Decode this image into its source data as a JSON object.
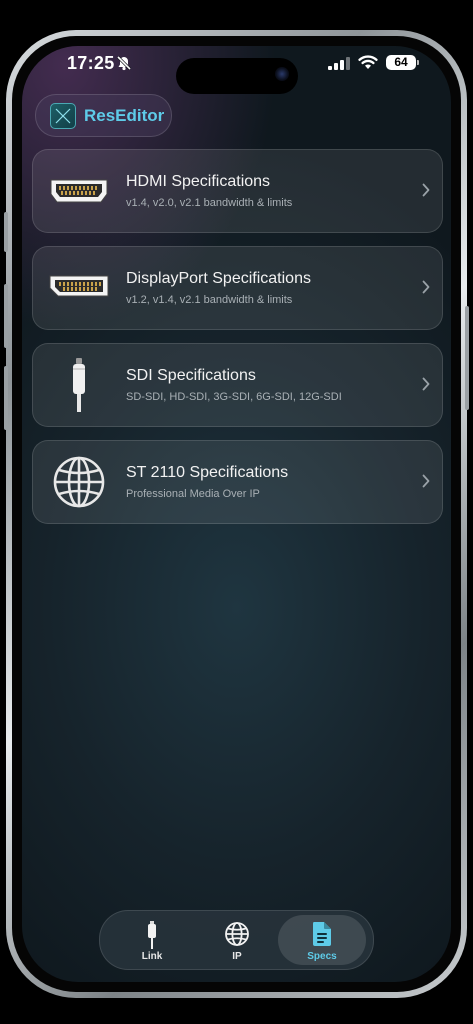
{
  "status_bar": {
    "time": "17:25",
    "battery": "64"
  },
  "app": {
    "name": "ResEditor"
  },
  "cards": [
    {
      "title": "HDMI Specifications",
      "subtitle": "v1.4, v2.0, v2.1 bandwidth & limits",
      "icon": "hdmi-connector-icon"
    },
    {
      "title": "DisplayPort Specifications",
      "subtitle": "v1.2, v1.4, v2.1 bandwidth & limits",
      "icon": "displayport-connector-icon"
    },
    {
      "title": "SDI Specifications",
      "subtitle": "SD-SDI, HD-SDI, 3G-SDI, 6G-SDI, 12G-SDI",
      "icon": "sdi-cable-icon"
    },
    {
      "title": "ST 2110 Specifications",
      "subtitle": "Professional Media Over IP",
      "icon": "globe-icon"
    }
  ],
  "tabs": [
    {
      "label": "Link",
      "icon": "cable-icon"
    },
    {
      "label": "IP",
      "icon": "globe-icon"
    },
    {
      "label": "Specs",
      "icon": "document-icon",
      "active": true
    }
  ],
  "colors": {
    "accent": "#5ecbe8"
  }
}
